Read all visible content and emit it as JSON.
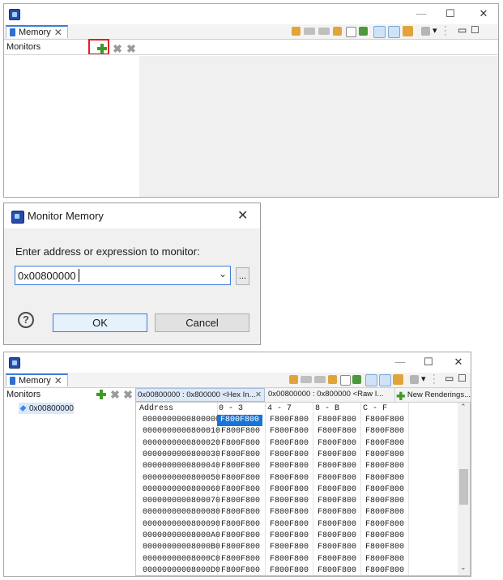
{
  "top_window": {
    "title_controls": {
      "minimize": "—",
      "maximize": "☐",
      "close": "✕"
    },
    "view_tab": {
      "label": "Memory",
      "close": "✕"
    },
    "monitors_label": "Monitors",
    "toolbar_view_menu": "▾"
  },
  "dialog": {
    "title": "Monitor Memory",
    "prompt": "Enter address or expression to monitor:",
    "input_value": "0x00800000",
    "browse_label": "...",
    "help_icon": "?",
    "ok_label": "OK",
    "cancel_label": "Cancel"
  },
  "bottom_window": {
    "title_controls": {
      "minimize": "—",
      "maximize": "☐",
      "close": "✕"
    },
    "view_tab": {
      "label": "Memory",
      "close": "✕"
    },
    "monitors_label": "Monitors",
    "monitor_item": "0x00800000",
    "renderings_tabs": [
      {
        "label": "0x00800000 : 0x800000 <Hex In...",
        "close": "✕"
      },
      {
        "label": "0x00800000 : 0x800000 <Raw I..."
      },
      {
        "label": "New Renderings..."
      }
    ],
    "table": {
      "headers": [
        "Address",
        "0 - 3",
        "4 - 7",
        "8 - B",
        "C - F"
      ],
      "rows": [
        [
          "0000000000800000",
          "F800F800",
          "F800F800",
          "F800F800",
          "F800F800"
        ],
        [
          "0000000000800010",
          "F800F800",
          "F800F800",
          "F800F800",
          "F800F800"
        ],
        [
          "0000000000800020",
          "F800F800",
          "F800F800",
          "F800F800",
          "F800F800"
        ],
        [
          "0000000000800030",
          "F800F800",
          "F800F800",
          "F800F800",
          "F800F800"
        ],
        [
          "0000000000800040",
          "F800F800",
          "F800F800",
          "F800F800",
          "F800F800"
        ],
        [
          "0000000000800050",
          "F800F800",
          "F800F800",
          "F800F800",
          "F800F800"
        ],
        [
          "0000000000800060",
          "F800F800",
          "F800F800",
          "F800F800",
          "F800F800"
        ],
        [
          "0000000000800070",
          "F800F800",
          "F800F800",
          "F800F800",
          "F800F800"
        ],
        [
          "0000000000800080",
          "F800F800",
          "F800F800",
          "F800F800",
          "F800F800"
        ],
        [
          "0000000000800090",
          "F800F800",
          "F800F800",
          "F800F800",
          "F800F800"
        ],
        [
          "00000000008000A0",
          "F800F800",
          "F800F800",
          "F800F800",
          "F800F800"
        ],
        [
          "00000000008000B0",
          "F800F800",
          "F800F800",
          "F800F800",
          "F800F800"
        ],
        [
          "00000000008000C0",
          "F800F800",
          "F800F800",
          "F800F800",
          "F800F800"
        ],
        [
          "00000000008000D0",
          "F800F800",
          "F800F800",
          "F800F800",
          "F800F800"
        ]
      ],
      "selected_cell": "F800F800"
    }
  },
  "colors": {
    "accent": "#3c7ddb",
    "selection": "#1874d6",
    "highlight_box": "#e02020",
    "add_green": "#3d9a2b"
  }
}
